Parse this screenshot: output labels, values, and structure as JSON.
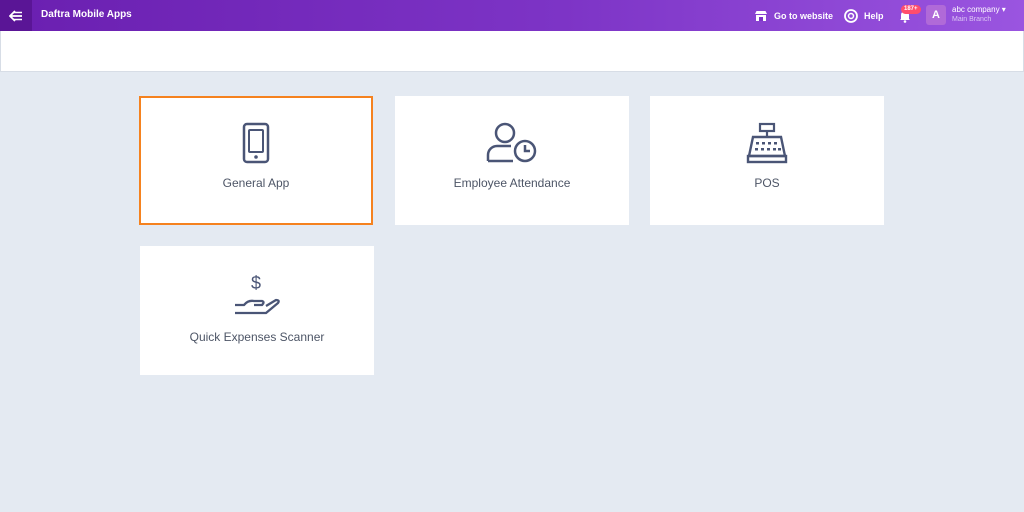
{
  "header": {
    "title": "Daftra Mobile Apps",
    "go_to_website": "Go to website",
    "help": "Help",
    "notifications_badge": "187+",
    "avatar_letter": "A",
    "company_name": "abc company ▾",
    "branch_name": "Main Branch",
    "brand_color": "#7d34c6"
  },
  "apps": [
    {
      "label": "General App",
      "icon": "mobile-phone-icon",
      "selected": true
    },
    {
      "label": "Employee Attendance",
      "icon": "user-clock-icon",
      "selected": false
    },
    {
      "label": "POS",
      "icon": "cash-register-icon",
      "selected": false
    },
    {
      "label": "Quick Expenses Scanner",
      "icon": "hand-dollar-icon",
      "selected": false
    }
  ],
  "colors": {
    "selected_border": "#f5821f",
    "icon": "#4a5576",
    "background": "#e4eaf2"
  }
}
